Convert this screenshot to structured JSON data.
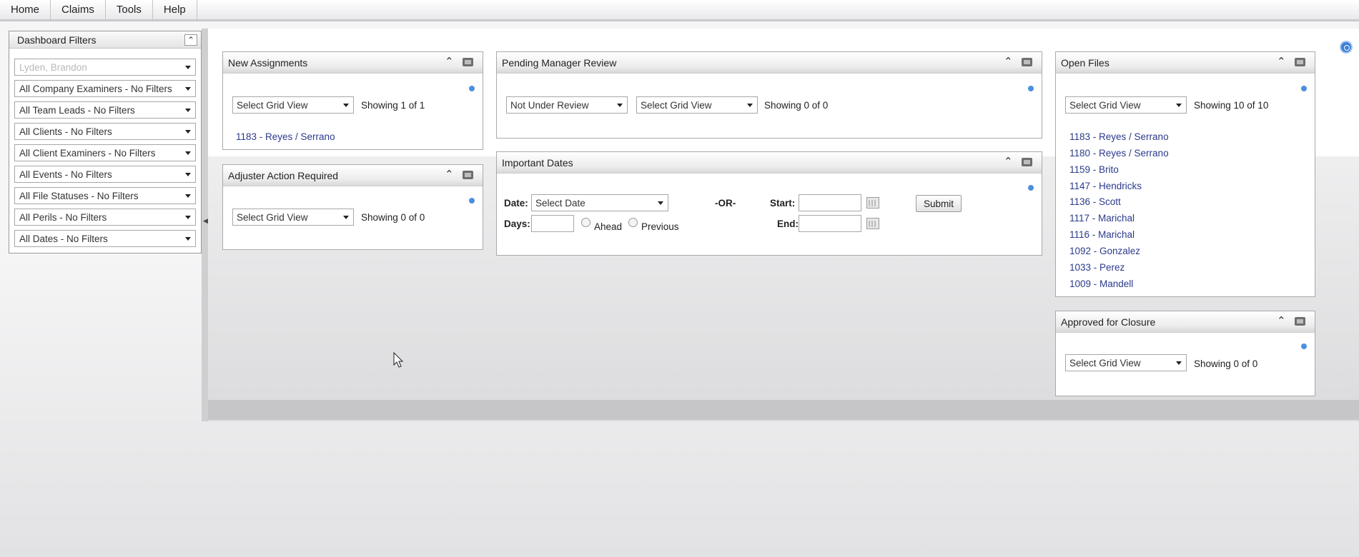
{
  "menu": {
    "items": [
      "Home",
      "Claims",
      "Tools",
      "Help"
    ]
  },
  "filters": {
    "title": "Dashboard Filters",
    "collapse_icon": "chevron-up-icon",
    "user_placeholder": "Lyden, Brandon",
    "selects": [
      "All Company Examiners - No Filters",
      "All Team Leads - No Filters",
      "All Clients - No Filters",
      "All Client Examiners - No Filters",
      "All Events - No Filters",
      "All File Statuses - No Filters",
      "All Perils - No Filters",
      "All Dates - No Filters"
    ]
  },
  "new_assignments": {
    "title": "New Assignments",
    "grid_view": "Select Grid View",
    "showing": "Showing  1 of 1",
    "items": [
      "1183 - Reyes / Serrano"
    ]
  },
  "adjuster_action": {
    "title": "Adjuster Action Required",
    "grid_view": "Select Grid View",
    "showing": "Showing  0 of 0"
  },
  "pending_review": {
    "title": "Pending Manager Review",
    "review_filter": "Not Under Review",
    "grid_view": "Select Grid View",
    "showing": "Showing  0 of 0"
  },
  "important_dates": {
    "title": "Important Dates",
    "date_label": "Date:",
    "date_select": "Select Date",
    "or_label": "-OR-",
    "start_label": "Start:",
    "end_label": "End:",
    "days_label": "Days:",
    "ahead_label": "Ahead",
    "previous_label": "Previous",
    "submit_label": "Submit"
  },
  "open_files": {
    "title": "Open Files",
    "grid_view": "Select Grid View",
    "showing": "Showing  10 of 10",
    "items": [
      "1183 - Reyes / Serrano",
      "1180 - Reyes / Serrano",
      "1159 - Brito",
      "1147 - Hendricks",
      "1136 - Scott",
      "1117 - Marichal",
      "1116 - Marichal",
      "1092 - Gonzalez",
      "1033 - Perez",
      "1009 - Mandell"
    ]
  },
  "approved_closure": {
    "title": "Approved for Closure",
    "grid_view": "Select Grid View",
    "showing": "Showing  0 of 0"
  },
  "colors": {
    "link": "#2b3a8c",
    "indicator": "#4d8fdd",
    "accent": "#3d7fd6"
  }
}
